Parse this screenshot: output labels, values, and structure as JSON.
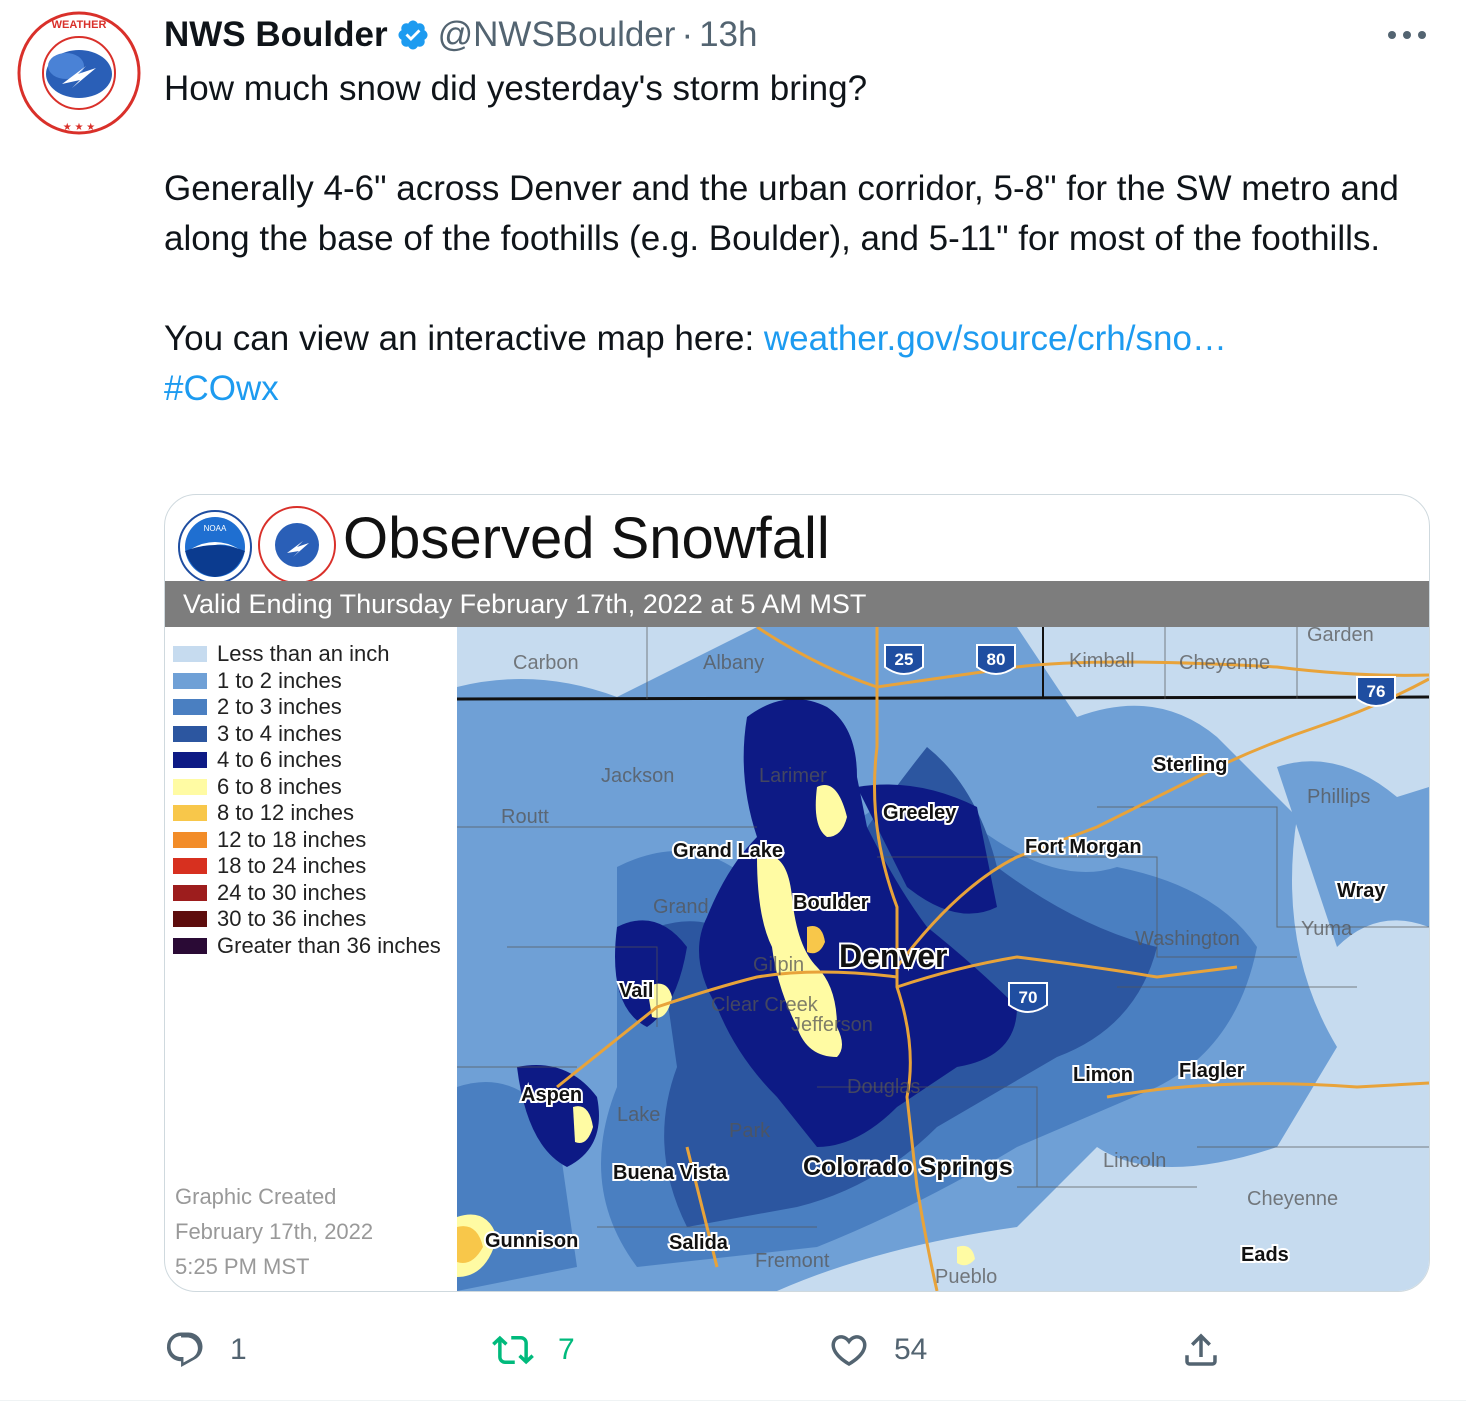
{
  "tweet": {
    "author": {
      "display_name": "NWS Boulder",
      "handle": "@NWSBoulder",
      "verified": true,
      "avatar_icon": "nws-logo-icon"
    },
    "separator": "·",
    "time": "13h",
    "more_icon": "more-horizontal-icon",
    "text": {
      "line1": "How much snow did yesterday's storm bring?",
      "para2": "Generally 4-6\" across Denver and the urban corridor, 5-8\" for the SW metro and along the base of the foothills (e.g. Boulder), and 5-11\" for most of the foothills.",
      "para3_prefix": "You can view an interactive map here: ",
      "para3_link": "weather.gov/source/crh/sno…",
      "hashtag": "#COwx"
    },
    "media": {
      "title": "Observed Snowfall",
      "valid_text": "Valid Ending Thursday February 17th, 2022 at 5 AM MST",
      "legend": [
        {
          "label": "Less than an inch",
          "color": "#c6dbef"
        },
        {
          "label": "1 to 2 inches",
          "color": "#6fa0d6"
        },
        {
          "label": "2 to 3 inches",
          "color": "#4a7fc1"
        },
        {
          "label": "3 to 4 inches",
          "color": "#2c56a0"
        },
        {
          "label": "4 to 6 inches",
          "color": "#0d1a85"
        },
        {
          "label": "6 to 8 inches",
          "color": "#fffba3"
        },
        {
          "label": "8 to 12 inches",
          "color": "#f8c74a"
        },
        {
          "label": "12 to 18 inches",
          "color": "#f28c28"
        },
        {
          "label": "18 to 24 inches",
          "color": "#d7301f"
        },
        {
          "label": "24 to 30 inches",
          "color": "#9d1d1d"
        },
        {
          "label": "30 to 36 inches",
          "color": "#5e0d0d"
        },
        {
          "label": "Greater than 36 inches",
          "color": "#2a0a35"
        }
      ],
      "created": [
        "Graphic Created",
        "February 17th, 2022",
        "5:25 PM MST"
      ],
      "map_labels": {
        "carbon": "Carbon",
        "albany": "Albany",
        "kimball": "Kimball",
        "cheyenne_wy": "Cheyenne",
        "garden": "Garden",
        "jackson": "Jackson",
        "larimer": "Larimer",
        "routt": "Routt",
        "grand_lake": "Grand Lake",
        "greeley": "Greeley",
        "sterling": "Sterling",
        "phillips": "Phillips",
        "fort_morgan": "Fort Morgan",
        "wray": "Wray",
        "yuma": "Yuma",
        "grand": "Grand",
        "boulder": "Boulder",
        "denver": "Denver",
        "washington": "Washington",
        "gilpin": "Gilpin",
        "vail": "Vail",
        "clear_creek": "Clear Creek",
        "jefferson": "Jefferson",
        "aspen": "Aspen",
        "lake": "Lake",
        "douglas": "Douglas",
        "limon": "Limon",
        "flagler": "Flagler",
        "park": "Park",
        "buena_vista": "Buena Vista",
        "colorado_springs": "Colorado Springs",
        "lincoln": "Lincoln",
        "cheyenne_co": "Cheyenne",
        "gunnison": "Gunnison",
        "salida": "Salida",
        "fremont": "Fremont",
        "pueblo": "Pueblo",
        "eads": "Eads"
      },
      "shields": {
        "i25": "25",
        "i80": "80",
        "i76": "76",
        "i70": "70"
      }
    },
    "actions": {
      "reply": {
        "icon": "reply-icon",
        "count": "1"
      },
      "retweet": {
        "icon": "retweet-icon",
        "count": "7"
      },
      "like": {
        "icon": "heart-icon",
        "count": "54"
      },
      "share": {
        "icon": "share-icon"
      }
    }
  }
}
